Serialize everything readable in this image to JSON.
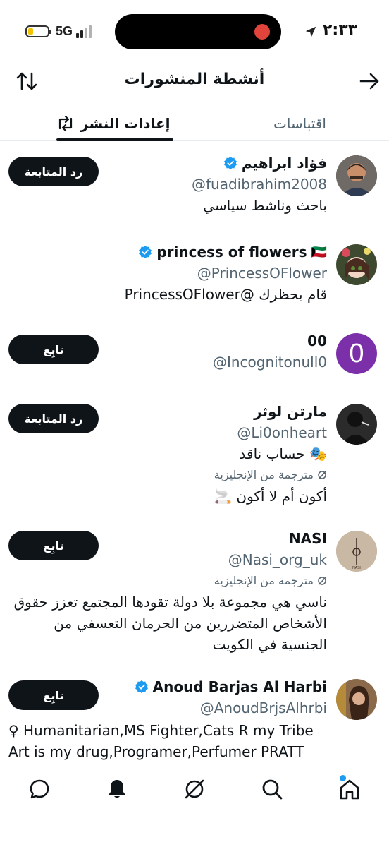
{
  "status": {
    "network": "5G",
    "time": "٢:٣٣"
  },
  "header": {
    "title": "أنشطة المنشورات"
  },
  "tabs": {
    "quotes": "اقتباسات",
    "reposts": "إعادات النشر"
  },
  "users": [
    {
      "name": "فؤاد ابراهيم",
      "verified": true,
      "handle": "@fuadibrahim2008",
      "bio": "باحث وناشط سياسي",
      "button": "رد المتابعة"
    },
    {
      "name": "princess of flowers",
      "flag": "🇰🇼",
      "verified": true,
      "handle": "@PrincessOFlower",
      "bio": "قام بحظرك @PrincessOFlower",
      "button": ""
    },
    {
      "name": "00",
      "verified": false,
      "handle": "@Incognitonull0",
      "avatar_letter": "0",
      "button": "تابِع"
    },
    {
      "name": "مارتن لوثر",
      "verified": false,
      "handle": "@Li0onheart",
      "bio": "🎭 حساب ناقد",
      "translated": "مترجمة من الإنجليزية",
      "bio2": "أكون أم لا أكون 🚬",
      "button": "رد المتابعة"
    },
    {
      "name": "NASI",
      "verified": false,
      "handle": "@Nasi_org_uk",
      "translated": "مترجمة من الإنجليزية",
      "bio": "ناسي هي مجموعة بلا دولة تقودها المجتمع تعزز حقوق الأشخاص المتضررين من الحرمان التعسفي من الجنسية في الكويت",
      "button": "تابِع"
    },
    {
      "name": "Anoud Barjas Al Harbi",
      "verified": true,
      "handle": "@AnoudBrjsAlhrbi",
      "bio": "♀ Humanitarian,MS Fighter,Cats R my Tribe Art is my drug,Programer,Perfumer PRATT",
      "button": "تابِع"
    }
  ],
  "colors": {
    "accent": "#1d9bf0",
    "text": "#0f1419",
    "secondary": "#536471",
    "avatar_purple": "#7b2fa8"
  }
}
